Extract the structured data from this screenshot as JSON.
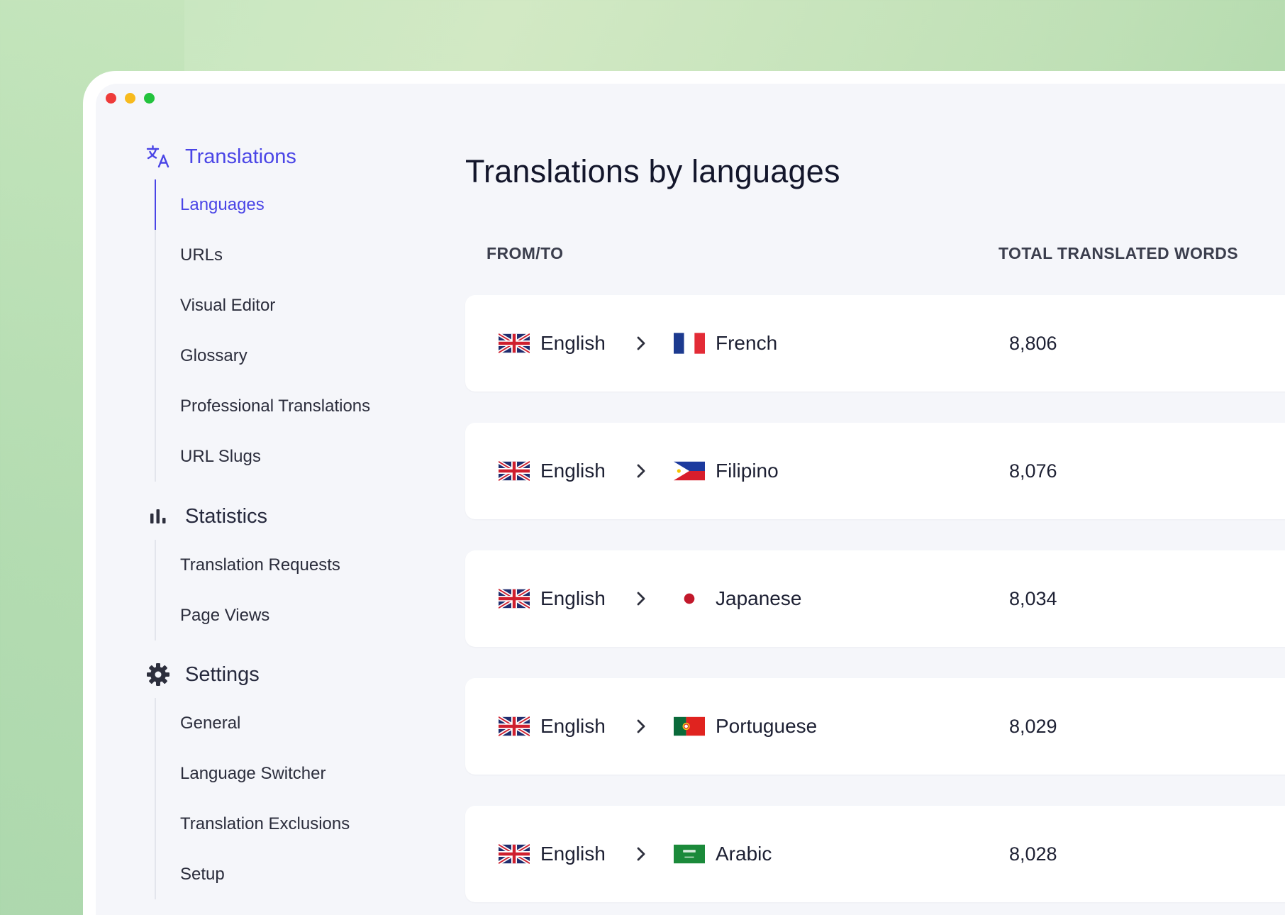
{
  "window": {
    "controls": [
      "close",
      "minimize",
      "maximize"
    ]
  },
  "sidebar": {
    "translations": {
      "label": "Translations",
      "icon": "translate-icon",
      "items": [
        "Languages",
        "URLs",
        "Visual Editor",
        "Glossary",
        "Professional Translations",
        "URL Slugs"
      ],
      "active_item": "Languages"
    },
    "statistics": {
      "label": "Statistics",
      "icon": "bar-chart-icon",
      "items": [
        "Translation Requests",
        "Page Views"
      ]
    },
    "settings": {
      "label": "Settings",
      "icon": "gear-icon",
      "items": [
        "General",
        "Language Switcher",
        "Translation Exclusions",
        "Setup"
      ]
    }
  },
  "main": {
    "title": "Translations by languages",
    "columns": {
      "from_to": "FROM/TO",
      "total": "TOTAL TRANSLATED WORDS"
    },
    "rows": [
      {
        "from": "English",
        "from_flag": "uk-flag",
        "to": "French",
        "to_flag": "france-flag",
        "total": "8,806"
      },
      {
        "from": "English",
        "from_flag": "uk-flag",
        "to": "Filipino",
        "to_flag": "philippines-flag",
        "total": "8,076"
      },
      {
        "from": "English",
        "from_flag": "uk-flag",
        "to": "Japanese",
        "to_flag": "japan-flag",
        "total": "8,034"
      },
      {
        "from": "English",
        "from_flag": "uk-flag",
        "to": "Portuguese",
        "to_flag": "portugal-flag",
        "total": "8,029"
      },
      {
        "from": "English",
        "from_flag": "uk-flag",
        "to": "Arabic",
        "to_flag": "saudi-arabia-flag",
        "total": "8,028"
      }
    ]
  },
  "colors": {
    "accent": "#4a45e6",
    "text": "#1d2033",
    "panel": "#f5f6fa",
    "card": "#ffffff"
  }
}
